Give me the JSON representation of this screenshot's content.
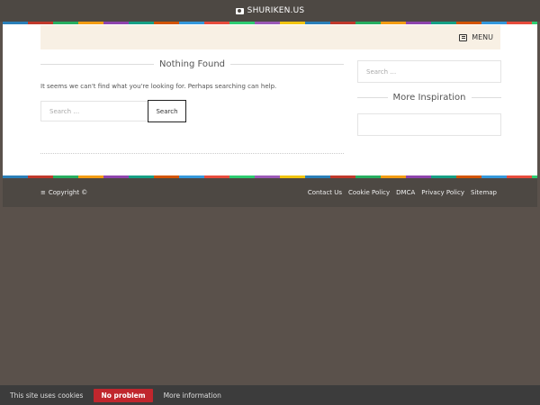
{
  "header": {
    "site_name": "SHURIKEN.US",
    "icon": "camera-icon"
  },
  "nav": {
    "menu_label": "MENU",
    "icon": "menu-icon"
  },
  "main": {
    "title": "Nothing Found",
    "message": "It seems we can't find what you're looking for. Perhaps searching can help.",
    "search_placeholder": "Search …",
    "search_button": "Search"
  },
  "sidebar": {
    "search_placeholder": "Search …",
    "inspiration_title": "More Inspiration"
  },
  "footer": {
    "copyright": "Copyright ©",
    "links": [
      "Contact Us",
      "Cookie Policy",
      "DMCA",
      "Privacy Policy",
      "Sitemap"
    ]
  },
  "cookie_bar": {
    "text": "This site uses cookies",
    "accept": "No problem",
    "more": "More information"
  }
}
